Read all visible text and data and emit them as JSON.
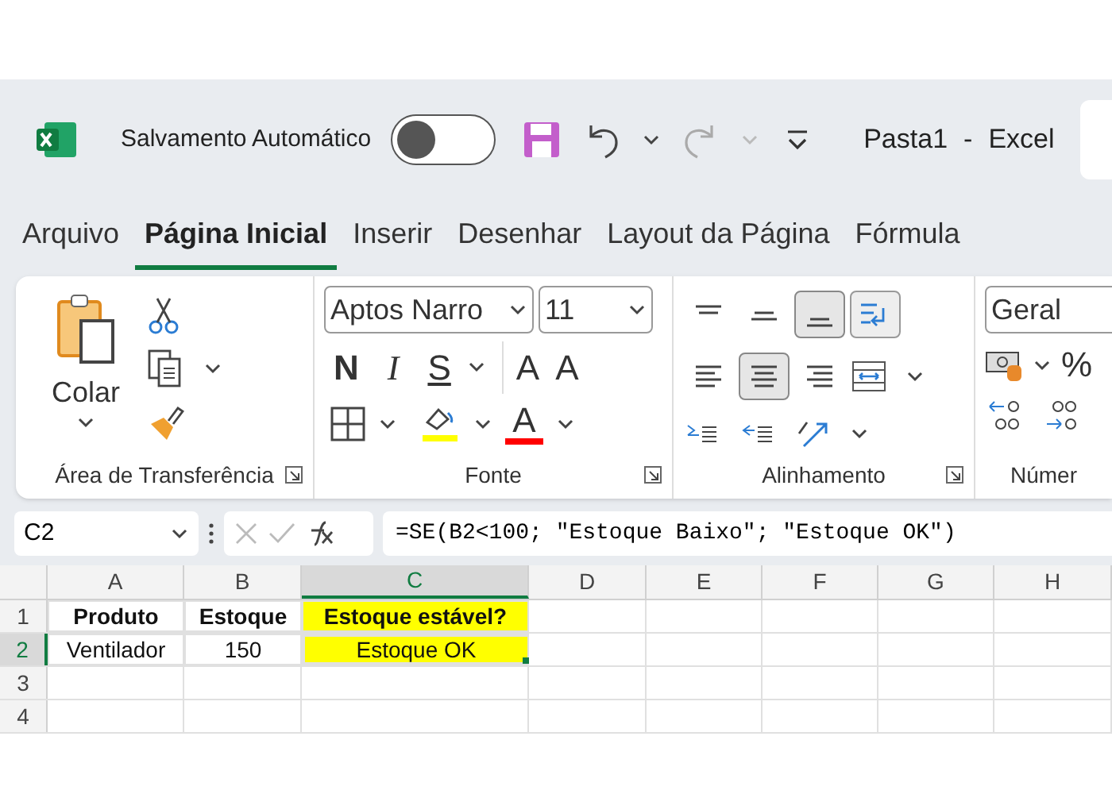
{
  "title_bar": {
    "autosave_label": "Salvamento Automático",
    "autosave_on": false,
    "file_name": "Pasta1",
    "separator": "-",
    "app_name": "Excel"
  },
  "tabs": [
    {
      "label": "Arquivo",
      "selected": false
    },
    {
      "label": "Página Inicial",
      "selected": true
    },
    {
      "label": "Inserir",
      "selected": false
    },
    {
      "label": "Desenhar",
      "selected": false
    },
    {
      "label": "Layout da Página",
      "selected": false
    },
    {
      "label": "Fórmula",
      "selected": false
    }
  ],
  "clipboard": {
    "paste_label": "Colar",
    "group_label": "Área de Transferência"
  },
  "font": {
    "font_name": "Aptos Narro",
    "size": "11",
    "bold_label": "N",
    "italic_label": "I",
    "underline_label": "S",
    "grow_label": "A",
    "shrink_label": "A",
    "color_label": "A",
    "group_label": "Fonte"
  },
  "alignment": {
    "vertical": [
      {
        "selected": false
      },
      {
        "selected": false
      },
      {
        "selected": true
      }
    ],
    "horizontal": [
      {
        "selected": false
      },
      {
        "selected": true
      },
      {
        "selected": false
      }
    ],
    "group_label": "Alinhamento"
  },
  "number": {
    "format": "Geral",
    "percent_label": "%",
    "group_label": "Númer"
  },
  "formula_bar": {
    "name_box": "C2",
    "formula": "=SE(B2<100; \"Estoque Baixo\"; \"Estoque OK\")"
  },
  "sheet": {
    "columns": [
      {
        "label": "A",
        "selected": false
      },
      {
        "label": "B",
        "selected": false
      },
      {
        "label": "C",
        "selected": true
      },
      {
        "label": "D",
        "selected": false
      },
      {
        "label": "E",
        "selected": false
      },
      {
        "label": "F",
        "selected": false
      },
      {
        "label": "G",
        "selected": false
      },
      {
        "label": "H",
        "selected": false
      }
    ],
    "rows": [
      {
        "header": "1",
        "selected": false,
        "cells": [
          {
            "text": "Produto",
            "bold": true
          },
          {
            "text": "Estoque",
            "bold": true
          },
          {
            "text": "Estoque estável?",
            "bold": true,
            "color": "#ffff00"
          }
        ]
      },
      {
        "header": "2",
        "selected": true,
        "cells": [
          {
            "text": "Ventilador",
            "bold": false
          },
          {
            "text": "150",
            "bold": false
          },
          {
            "text": "Estoque OK",
            "bold": false,
            "color": "#ffff00",
            "active": true
          }
        ]
      },
      {
        "header": "3",
        "selected": false,
        "cells": []
      },
      {
        "header": "4",
        "selected": false,
        "cells": []
      }
    ]
  }
}
